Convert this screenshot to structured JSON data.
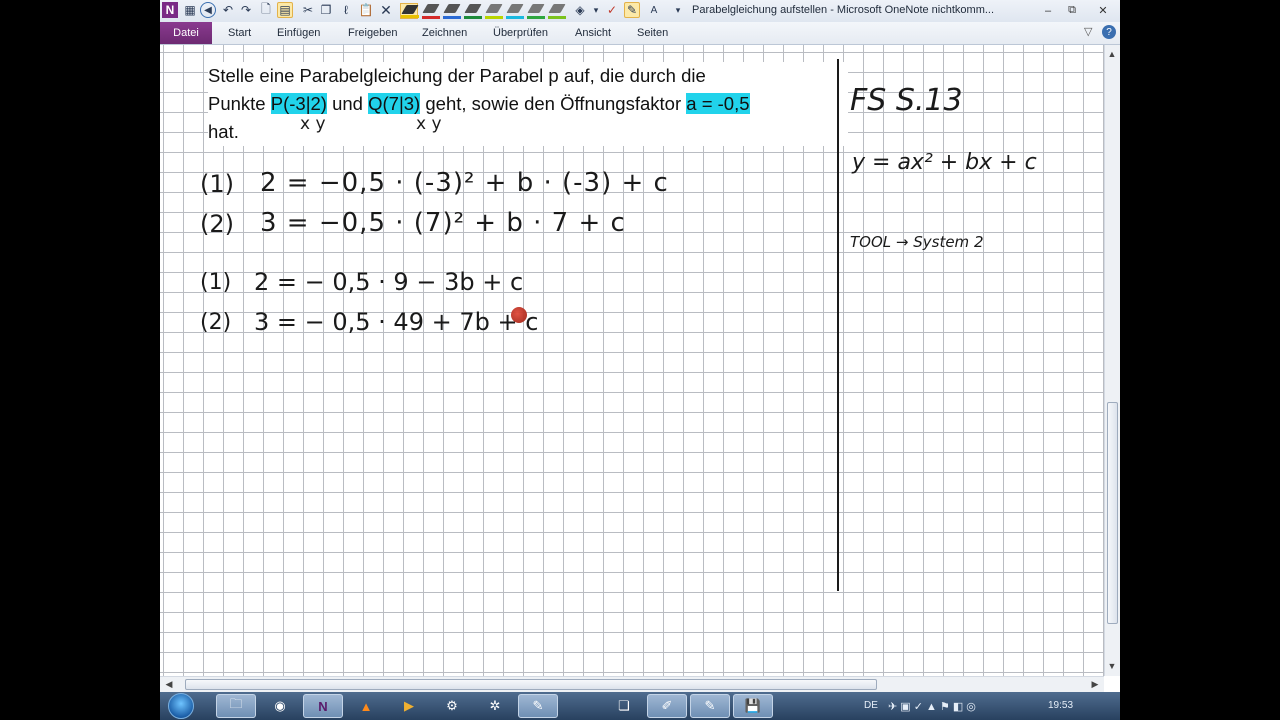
{
  "window": {
    "title": "Parabelgleichung aufstellen - Microsoft OneNote nichtkomm...",
    "controls": [
      "–",
      "⧉",
      "✕"
    ]
  },
  "toolbar": {
    "icons": [
      "onenote-icon",
      "table-icon",
      "back-icon",
      "undo-icon",
      "redo-icon",
      "print-preview-icon",
      "select-icon",
      "cut-icon",
      "copy-icon",
      "lasso-icon",
      "paste-icon",
      "eraser-icon"
    ],
    "pen_colors": [
      "#e8c100",
      "#d42a2a",
      "#2a6ad4",
      "#1c8a3a",
      "#b8d400",
      "#19b8e0",
      "#2ea640",
      "#7bc21f"
    ],
    "more_glyphs": [
      "▾",
      "✓",
      "A"
    ]
  },
  "ribbon": {
    "file_tab": "Datei",
    "tabs": [
      "Start",
      "Einfügen",
      "Freigeben",
      "Zeichnen",
      "Überprüfen",
      "Ansicht",
      "Seiten"
    ],
    "right_glyphs": [
      "▽",
      "?"
    ]
  },
  "note": {
    "line1": "Stelle eine Parabelgleichung der Parabel p auf, die durch die",
    "line2_pre": "Punkte ",
    "point_p": "P(-3|2)",
    "line2_mid": " und ",
    "point_q": "Q(7|3)",
    "line2_post": " geht, sowie den Öffnungsfaktor ",
    "factor": "a = -0,5",
    "line3": "hat."
  },
  "handwriting": {
    "xy_under_p": "x  y",
    "xy_under_q": "x  y",
    "eq1_label": "(1)",
    "eq1": "2  =  −0,5 · (-3)² + b · (-3)  + c",
    "eq2_label": "(2)",
    "eq2": "3  =  −0,5 · (7)²  + b · 7    + c",
    "eq3_label": "(1)",
    "eq3": "2   =  − 0,5 · 9   − 3b    + c",
    "eq4_label": "(2)",
    "eq4": "3   =  − 0,5 · 49 + 7b    + c",
    "side_ref": "FS  S.13",
    "side_formula": "y = ax² + bx + c",
    "side_tool": "TOOL → System 2"
  },
  "taskbar": {
    "apps": [
      "explorer-icon",
      "firefox-icon",
      "onenote-icon",
      "vlc-icon",
      "media-player-icon",
      "settings-icon",
      "tool-icon",
      "network-icon",
      "files-icon",
      "tool2-icon",
      "save-icon"
    ],
    "lang": "DE",
    "clock": "19:53"
  }
}
